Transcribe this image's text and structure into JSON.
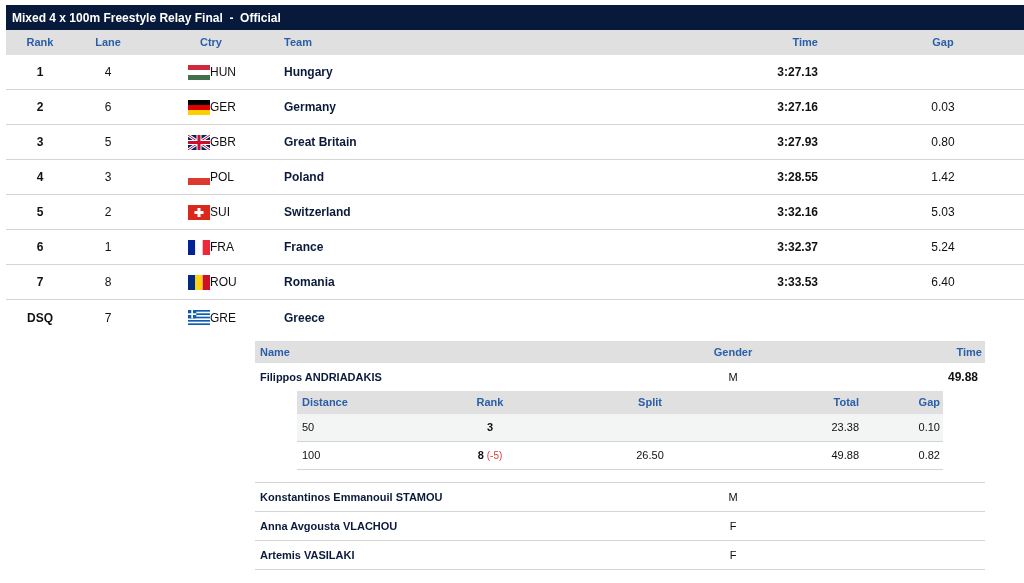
{
  "title": "Mixed 4 x 100m Freestyle Relay Final  -  Official",
  "columns": [
    "Rank",
    "Lane",
    "Ctry",
    "Team",
    "Time",
    "Gap"
  ],
  "rows": [
    {
      "rank": "1",
      "lane": "4",
      "flag": {
        "kind": "hu"
      },
      "ctry": "HUN",
      "team": "Hungary",
      "time": "3:27.13"
    },
    {
      "rank": "2",
      "lane": "6",
      "flag": {
        "kind": "de"
      },
      "ctry": "GER",
      "team": "Germany",
      "time": "3:27.16",
      "gap": "0.03"
    },
    {
      "rank": "3",
      "lane": "5",
      "flag": {
        "kind": "gb"
      },
      "ctry": "GBR",
      "team": "Great Britain",
      "time": "3:27.93",
      "gap": "0.80"
    },
    {
      "rank": "4",
      "lane": "3",
      "flag": {
        "kind": "pl"
      },
      "ctry": "POL",
      "team": "Poland",
      "time": "3:28.55",
      "gap": "1.42"
    },
    {
      "rank": "5",
      "lane": "2",
      "flag": {
        "kind": "ch"
      },
      "ctry": "SUI",
      "team": "Switzerland",
      "time": "3:32.16",
      "gap": "5.03"
    },
    {
      "rank": "6",
      "lane": "1",
      "flag": {
        "kind": "fr"
      },
      "ctry": "FRA",
      "team": "France",
      "time": "3:32.37",
      "gap": "5.24"
    },
    {
      "rank": "7",
      "lane": "8",
      "flag": {
        "kind": "ro"
      },
      "ctry": "ROU",
      "team": "Romania",
      "time": "3:33.53",
      "gap": "6.40"
    },
    {
      "rank": "DSQ",
      "lane": "7",
      "flag": {
        "kind": "gr"
      },
      "ctry": "GRE",
      "team": "Greece",
      "swimmer_columns": [
        "Name",
        "Gender",
        "Time"
      ],
      "split_columns": [
        "Distance",
        "Rank",
        "Split",
        "Total",
        "Gap"
      ],
      "swimmers": [
        {
          "name": "Filippos ANDRIADAKIS",
          "gender": "M",
          "time": "49.88",
          "splits": [
            {
              "distance": "50",
              "rank": "3",
              "total": "23.38",
              "gap": "0.10"
            },
            {
              "distance": "100",
              "rank": "8",
              "change": "(-5)",
              "split": "26.50",
              "total": "49.88",
              "gap": "0.82"
            }
          ]
        },
        {
          "name": "Konstantinos Emmanouil STAMOU",
          "gender": "M"
        },
        {
          "name": "Anna Avgousta VLACHOU",
          "gender": "F"
        },
        {
          "name": "Artemis VASILAKI",
          "gender": "F"
        }
      ]
    }
  ]
}
